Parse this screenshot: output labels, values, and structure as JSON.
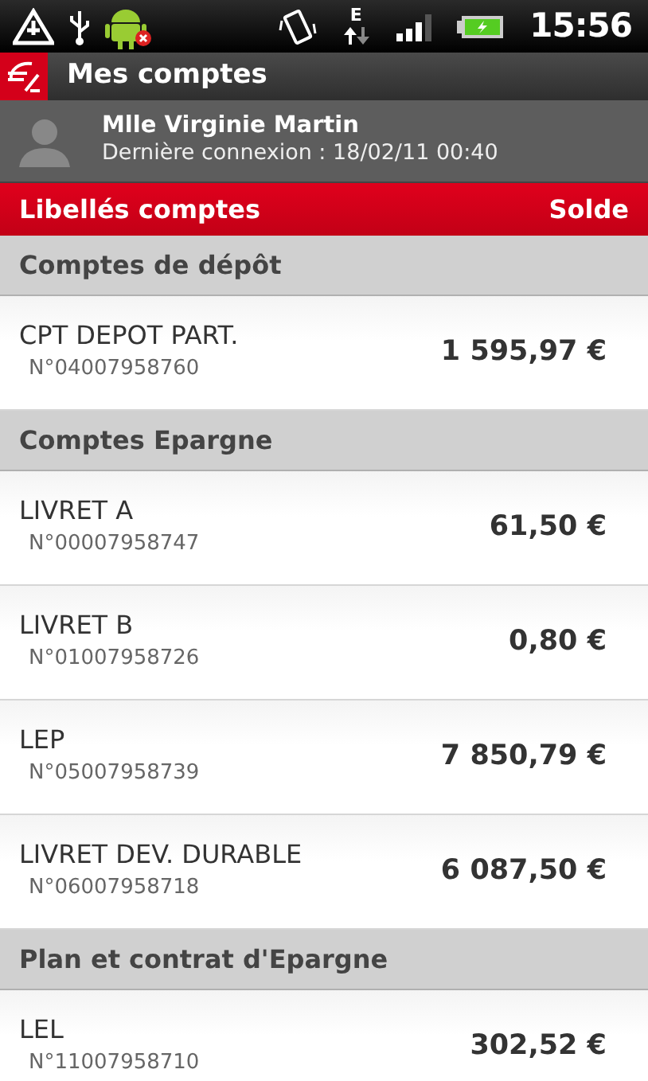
{
  "status_bar": {
    "time": "15:56",
    "network": "E"
  },
  "app_bar": {
    "title": "Mes comptes"
  },
  "user": {
    "name": "Mlle Virginie Martin",
    "last_login": "Dernière connexion : 18/02/11 00:40"
  },
  "table_header": {
    "label_column": "Libellés comptes",
    "balance_column": "Solde"
  },
  "sections": [
    {
      "title": "Comptes de dépôt",
      "accounts": [
        {
          "name": "CPT DEPOT PART.",
          "number": "N°04007958760",
          "balance": "1 595,97 €"
        }
      ]
    },
    {
      "title": "Comptes Epargne",
      "accounts": [
        {
          "name": "LIVRET A",
          "number": "N°00007958747",
          "balance": "61,50 €"
        },
        {
          "name": "LIVRET B",
          "number": "N°01007958726",
          "balance": "0,80 €"
        },
        {
          "name": "LEP",
          "number": "N°05007958739",
          "balance": "7 850,79 €"
        },
        {
          "name": "LIVRET DEV. DURABLE",
          "number": "N°06007958718",
          "balance": "6 087,50 €"
        }
      ]
    },
    {
      "title": "Plan et contrat d'Epargne",
      "accounts": [
        {
          "name": "LEL",
          "number": "N°11007958710",
          "balance": "302,52 €"
        }
      ]
    }
  ]
}
